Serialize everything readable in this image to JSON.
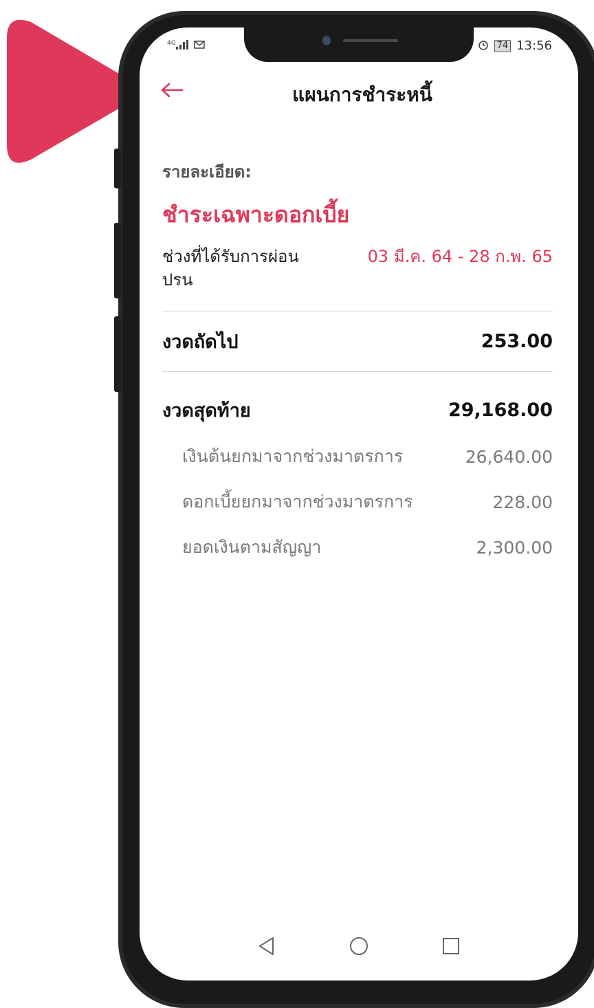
{
  "status_bar": {
    "signal": "4G",
    "battery": "74",
    "time": "13:56"
  },
  "header": {
    "back_icon": "arrow-left-icon",
    "title": "แผนการชำระหนี้"
  },
  "details": {
    "label": "รายละเอียด:",
    "plan_name": "ชำระเฉพาะดอกเบี้ย",
    "period_label": "ช่วงที่ได้รับการผ่อน",
    "period_value": "03 มี.ค. 64 - 28 ก.พ. 65",
    "period_label_cont": "ปรน"
  },
  "next_installment": {
    "label": "งวดถัดไป",
    "amount": "253.00"
  },
  "final_installment": {
    "label": "งวดสุดท้าย",
    "amount": "29,168.00",
    "items": [
      {
        "label": "เงินต้นยกมาจากช่วงมาตรการ",
        "amount": "26,640.00"
      },
      {
        "label": "ดอกเบี้ยยกมาจากช่วงมาตรการ",
        "amount": "228.00"
      },
      {
        "label": "ยอดเงินตามสัญญา",
        "amount": "2,300.00"
      }
    ]
  },
  "colors": {
    "accent": "#e0385a",
    "pointer": "#e0385a"
  }
}
